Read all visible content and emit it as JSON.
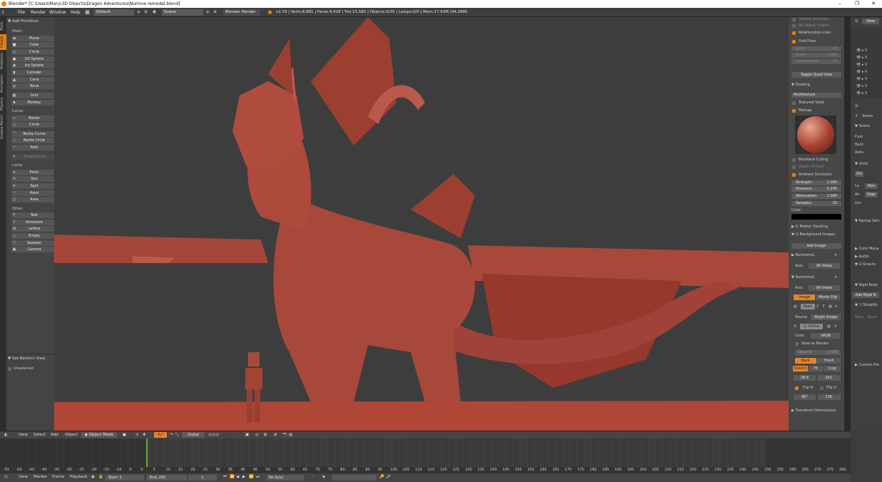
{
  "title_bar": {
    "text": "Blender* [C:\\Users\\Mary\\3D Objects\\Dragon Adventures\\Numine remodel.blend]"
  },
  "info_bar": {
    "menus": [
      "File",
      "Render",
      "Window",
      "Help"
    ],
    "layout": "Default",
    "scene": "Scene",
    "engine": "Blender Render",
    "stats": "v2.79 | Verts:8,981 | Faces:9,418 | Tris:15,582 | Objects:0/20 | Lamps:0/0 | Mem:17.63M (44.26M)"
  },
  "vertical_tabs": [
    "Tools",
    "Create",
    "Relations",
    "Animation",
    "Physics",
    "Grease Pencil"
  ],
  "toolshelf": {
    "panel_title": "Add Primitive",
    "mesh_label": "Mesh:",
    "mesh": [
      "Plane",
      "Cube",
      "Circle",
      "UV Sphere",
      "Ico Sphere",
      "Cylinder",
      "Cone",
      "Torus",
      "Grid",
      "Monkey"
    ],
    "curve_label": "Curve:",
    "curve": [
      "Bezier",
      "Circle",
      "Nurbs Curve",
      "Nurbs Circle",
      "Path"
    ],
    "draw_curve": "Draw Curve",
    "lamp_label": "Lamp:",
    "lamp": [
      "Point",
      "Sun",
      "Spot",
      "Hemi",
      "Area"
    ],
    "other_label": "Other:",
    "other": [
      "Text",
      "Armature",
      "Lattice",
      "Empty",
      "Speaker",
      "Camera"
    ],
    "set_restrict": "Set Restrict View",
    "unselected": "Unselected"
  },
  "properties": {
    "outline_selected": "Outline Selected",
    "all_object_origins": "All Object Origins",
    "relationship_lines": "Relationship Lines",
    "grid_floor": "Grid Floor",
    "lines": "Lines:",
    "lines_val": "16",
    "scale": "Scale:",
    "scale_val": "1.000",
    "subdivisions": "Subdivisions:",
    "subdivisions_val": "10",
    "toggle_quad": "Toggle Quad View",
    "shading": "Shading",
    "multitexture": "Multitexture",
    "textured_solid": "Textured Solid",
    "matcap": "Matcap",
    "backface": "Backface Culling",
    "dof": "Depth Of Field",
    "ao": "Ambient Occlusion",
    "strength": "Strength:",
    "strength_val": "1.000",
    "distance": "Distance:",
    "distance_val": "0.200",
    "attenuation": "Attenuation:",
    "attenuation_val": "1.000",
    "samples": "Samples:",
    "samples_val": "20",
    "color": "Color:",
    "motion_tracking": "Motion Tracking",
    "bg_images": "Background Images",
    "add_image": "Add Image",
    "img1": "Numinend...",
    "axis": "Axis:",
    "all_views": "All Views",
    "img2": "Numinend...",
    "image_btn": "Image",
    "movie_clip": "Movie Clip",
    "num": "Num",
    "num_count": "2",
    "source": "Source",
    "single_image": "Single Image",
    "path": "//..\\Pictur",
    "color_lbl": "Color",
    "srgb": "sRGB",
    "view_as_render": "View as Render",
    "opacity": "Opacity:",
    "opacity_val": "0.580",
    "back": "Back",
    "front": "Front",
    "stretch": "Stretch",
    "fit": "Fit",
    "crop": "Crop",
    "x_val": "28.8",
    "y_val": "162.",
    "flip_h": "Flip H",
    "flip_v": "Flip V",
    "rot_val": "90°",
    "size_val": "136.",
    "transform_orient": "Transform Orientations"
  },
  "outliner": {
    "view": "View",
    "scene": "Scene",
    "scene2": "Scene",
    "cam": "Cam",
    "back": "Back",
    "activ": "Activ",
    "units": "Units",
    "uni": "Uni",
    "le": "Le",
    "non": "Non",
    "an": "An",
    "deg": "Degr",
    "uni2": "Uni",
    "keying": "Keying Sets",
    "color_mgmt": "Color Mana",
    "audio": "Audio",
    "gravity": "Gravity",
    "rigid": "Rigid Body",
    "add_rigid": "Add Rigid B",
    "simplify": "Simplify",
    "view2": "View",
    "rend": "Rend",
    "custom": "Custom Pro"
  },
  "view3d_header": {
    "items": [
      "View",
      "Select",
      "Add",
      "Object"
    ],
    "mode": "Object Mode",
    "orientation": "Global"
  },
  "timeline": {
    "ticks": [
      "-55",
      "-50",
      "-45",
      "-40",
      "-35",
      "-30",
      "-25",
      "-20",
      "-15",
      "-10",
      "-5",
      "0",
      "5",
      "10",
      "15",
      "20",
      "25",
      "30",
      "35",
      "40",
      "45",
      "50",
      "55",
      "60",
      "65",
      "70",
      "75",
      "80",
      "85",
      "90",
      "95",
      "100",
      "105",
      "110",
      "115",
      "120",
      "125",
      "130",
      "135",
      "140",
      "145",
      "150",
      "155",
      "160",
      "165",
      "170",
      "175",
      "180",
      "185",
      "190",
      "195",
      "200",
      "205",
      "210",
      "215",
      "220",
      "225",
      "230",
      "235",
      "240",
      "245",
      "250",
      "255",
      "260",
      "265",
      "270",
      "275",
      "280"
    ],
    "current_frame": 1,
    "menus": [
      "View",
      "Marker",
      "Frame",
      "Playback"
    ],
    "start_label": "Start:",
    "start": "1",
    "end_label": "End:",
    "end": "250",
    "frame": "1",
    "sync": "No Sync"
  },
  "colors": {
    "accent": "#e87d0d",
    "model": "#a84a3a",
    "floor": "#b24a3a"
  }
}
